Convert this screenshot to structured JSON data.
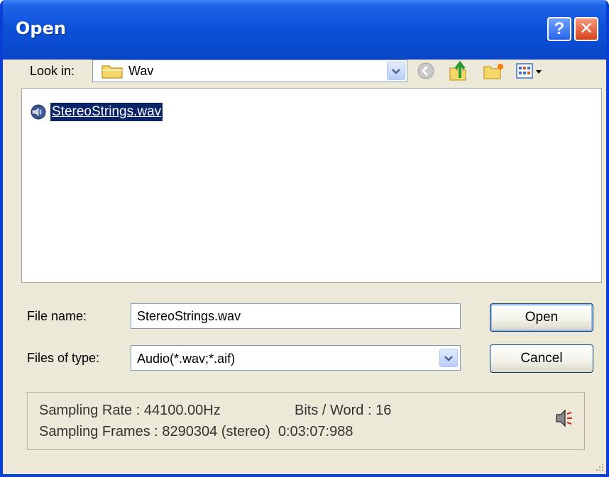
{
  "window": {
    "title": "Open",
    "help_label": "?",
    "close_label": "✕"
  },
  "lookin": {
    "label": "Look in:",
    "value": "Wav"
  },
  "toolbar": {
    "icons": [
      "back-icon",
      "up-folder-icon",
      "new-folder-icon",
      "view-menu-icon"
    ]
  },
  "filelist": {
    "items": [
      {
        "name": "StereoStrings.wav",
        "icon": "audio-file-icon",
        "selected": true
      }
    ]
  },
  "form": {
    "filename_label": "File name:",
    "filename_value": "StereoStrings.wav",
    "filetype_label": "Files of type:",
    "filetype_value": "Audio(*.wav;*.aif)"
  },
  "buttons": {
    "open_label": "Open",
    "cancel_label": "Cancel"
  },
  "info": {
    "sampling_rate": "Sampling Rate : 44100.00Hz",
    "bits_per_word": "Bits / Word : 16",
    "sampling_frames": "Sampling Frames : 8290304 (stereo)  0:03:07:988"
  },
  "colors": {
    "titlebar": "#0a4ad0",
    "selection": "#0a246a",
    "dialog_bg": "#ece9d8"
  }
}
